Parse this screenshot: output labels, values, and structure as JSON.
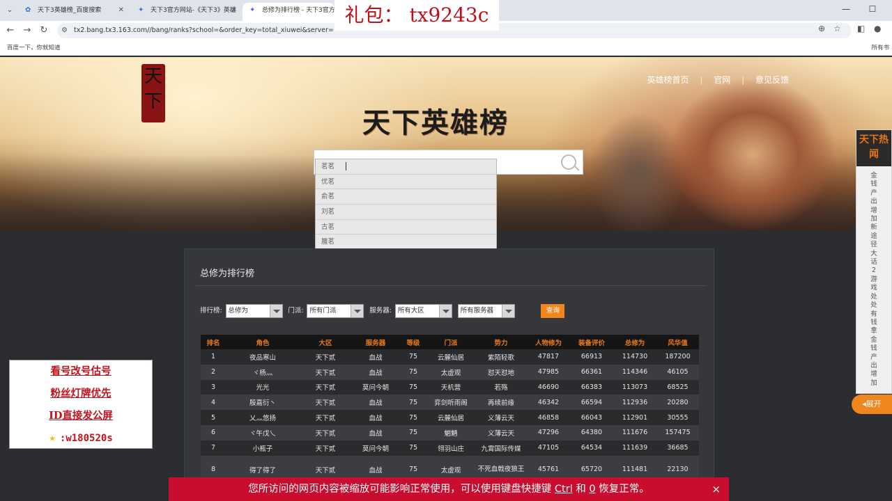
{
  "browser": {
    "tabs": [
      {
        "title": "天下3英雄榜_百度搜索"
      },
      {
        "title": "天下3官方网站-《天下3》英雄"
      },
      {
        "title": "总修为排行榜 - 天下3官方网站"
      }
    ],
    "url": "tx2.bang.tx3.163.com//bang/ranks?school=&order_key=total_xiuwei&server=",
    "bookmark_left": "百度一下，你就知道",
    "bookmark_right": "所有书"
  },
  "overlay_gift": "礼包：   tx9243c",
  "hero": {
    "logo_text": "天下",
    "title": "天下英雄榜",
    "nav": [
      "英雄榜首页",
      "|",
      "官网",
      "|",
      "意见反馈"
    ]
  },
  "search": {
    "suggestions": [
      "茗茗",
      "优茗",
      "俞茗",
      "刘茗",
      "古茗",
      "蜃茗"
    ]
  },
  "side_news": {
    "head": "天下热闻",
    "vertical_text": "金钱产出增加新途径大话2游戏处处有钱拿金钱产出增加",
    "expand": "展开"
  },
  "promo": {
    "lines": [
      "看号改号估号",
      "粉丝灯牌优先",
      "ID直接发公屏"
    ],
    "star_line": ":w180520s"
  },
  "panel": {
    "title": "总修为排行榜",
    "filters": {
      "rank_label": "排行榜:",
      "rank_value": "总修为",
      "school_label": "门派:",
      "school_value": "所有门派",
      "server_label": "服务器:",
      "region_value": "所有大区",
      "server_value": "所有服务器",
      "query": "查询"
    },
    "columns": [
      "排名",
      "角色",
      "大区",
      "服务器",
      "等级",
      "门派",
      "势力",
      "人物修为",
      "装备评价",
      "总修为",
      "风华值"
    ],
    "rows": [
      [
        "1",
        "夜品寒山",
        "天下贰",
        "血战",
        "75",
        "云麓仙居",
        "紫陌轻歌",
        "47817",
        "66913",
        "114730",
        "187200"
      ],
      [
        "2",
        "ヾ杨灬",
        "天下贰",
        "血战",
        "75",
        "太虚观",
        "怼天怼地",
        "47985",
        "66361",
        "114346",
        "46105"
      ],
      [
        "3",
        "光光",
        "天下贰",
        "莫问今朝",
        "75",
        "天机营",
        "若殇",
        "46690",
        "66383",
        "113073",
        "68525"
      ],
      [
        "4",
        "殷嘉衍丶",
        "天下贰",
        "血战",
        "75",
        "弈剑听雨阁",
        "再续前缘",
        "46342",
        "66594",
        "112936",
        "20280"
      ],
      [
        "5",
        "乂灬悠扬",
        "天下贰",
        "血战",
        "75",
        "云麓仙居",
        "义薄云天",
        "46858",
        "66043",
        "112901",
        "30555"
      ],
      [
        "6",
        "ヾ午戊乀",
        "天下贰",
        "血战",
        "75",
        "魍魉",
        "义薄云天",
        "47296",
        "64380",
        "111676",
        "157475"
      ],
      [
        "7",
        "小瓶子",
        "天下贰",
        "莫问今朝",
        "75",
        "翎羽山庄",
        "九霄国际传媒",
        "47105",
        "64534",
        "111639",
        "36685"
      ],
      [
        "8",
        "得了得了",
        "天下贰",
        "血战",
        "75",
        "太虚观",
        "不死血戟夜狼王",
        "45761",
        "65720",
        "111481",
        "22130"
      ]
    ]
  },
  "zoom_warning": {
    "text_before": "您所访问的网页内容被缩放可能影响正常使用，可以使用键盘快捷键 ",
    "key1": "Ctrl",
    "text_mid": " 和 ",
    "key2": "0",
    "text_after": " 恢复正常。",
    "close": "×"
  }
}
